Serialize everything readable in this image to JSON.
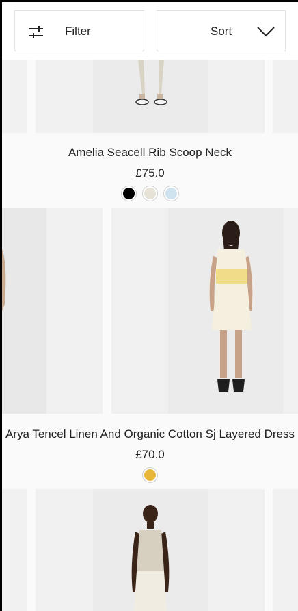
{
  "toolbar": {
    "filter_label": "Filter",
    "filter_icon": "sliders-icon",
    "sort_label": "Sort",
    "sort_icon": "chevron-down-icon"
  },
  "products": [
    {
      "name": "Amelia Seacell Rib Scoop Neck",
      "price": "£75.0",
      "swatches": [
        "#000000",
        "#e6e2d6",
        "#cfe3ee"
      ]
    },
    {
      "name": "Arya Tencel Linen And Organic Cotton Sj Layered Dress",
      "price": "£70.0",
      "swatches": [
        "#e9b63c"
      ]
    }
  ],
  "colors": {
    "background": "#fafafa",
    "tile": "#f0f0f0",
    "border": "#e2e2e2",
    "text": "#222222"
  }
}
